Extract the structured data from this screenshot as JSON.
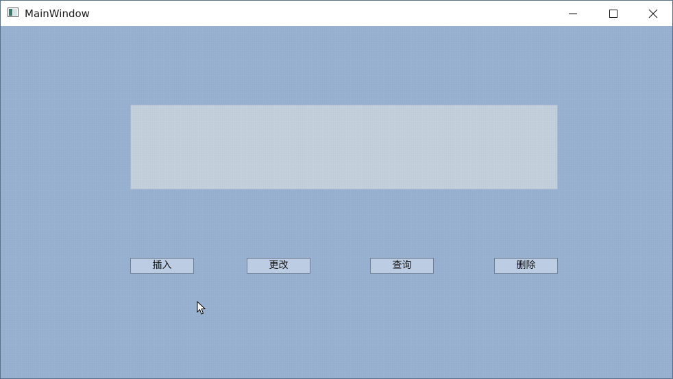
{
  "window": {
    "title": "MainWindow",
    "controls": [
      "minimize-icon",
      "maximize-icon",
      "close-icon"
    ]
  },
  "main": {
    "text_area_value": "",
    "buttons": {
      "insert": "插入",
      "update": "更改",
      "query": "查询",
      "delete": "删除"
    }
  },
  "colors": {
    "client_background": "#98b1d0",
    "text_area_background": "#c4cfdc",
    "button_background": "#bccde3"
  }
}
